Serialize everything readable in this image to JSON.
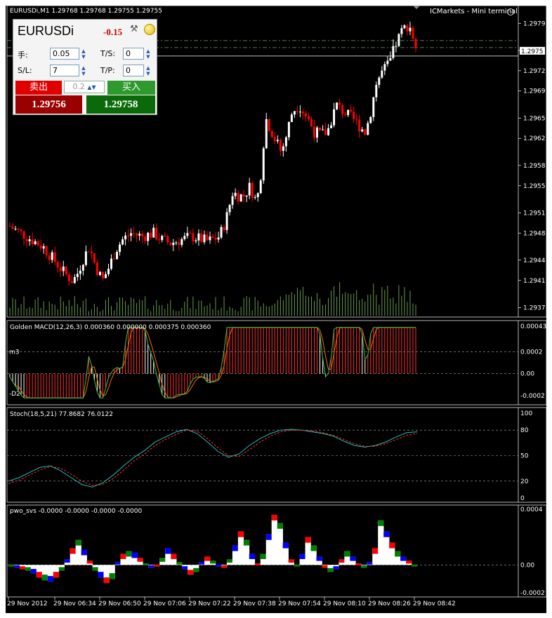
{
  "window": {
    "header_title": "EURUSDi,M1  1.29768 1.29768 1.29755 1.29755",
    "broker_label": "ICMarkets - Mini terminal"
  },
  "trade_panel": {
    "symbol": "EURUSDi",
    "change": "-0.15",
    "lots_label": "手:",
    "lots_value": "0.05",
    "ts_label": "T/S:",
    "ts_value": "0",
    "sl_label": "S/L:",
    "sl_value": "7",
    "tp_label": "T/P:",
    "tp_value": "0",
    "sell_label": "卖出",
    "sell_price": "1.29756",
    "buy_label": "买入",
    "buy_price": "1.29758",
    "spread": "0.2"
  },
  "colors": {
    "background": "#000000",
    "bull": "#ffffff",
    "bear": "#ff0000",
    "volume": "#6a9a50",
    "macd_signal": "#ff6a00",
    "stoch_main": "#20c0c0",
    "stoch_signal": "#ff3030",
    "pwo_green": "#008000",
    "pwo_blue": "#0000ff",
    "pwo_red": "#ff0000"
  },
  "chart_data": [
    {
      "type": "candlestick",
      "symbol": "EURUSDi",
      "timeframe": "M1",
      "ylim": [
        1.2936,
        1.2981
      ],
      "y_ticks": [
        "1.2979",
        "1.2975",
        "1.2972",
        "1.2969",
        "1.2965",
        "1.2962",
        "1.2958",
        "1.2955",
        "1.2951",
        "1.2948",
        "1.2944",
        "1.2941",
        "1.2937"
      ],
      "current_price": "1.2975",
      "x_ticks": [
        "29 Nov 2012",
        "29 Nov 06:34",
        "29 Nov 06:50",
        "29 Nov 07:06",
        "29 Nov 07:22",
        "29 Nov 07:38",
        "29 Nov 07:54",
        "29 Nov 08:10",
        "29 Nov 08:26",
        "29 Nov 08:42"
      ],
      "path_points": [
        [
          0,
          1.2949
        ],
        [
          10,
          1.2948
        ],
        [
          20,
          1.2947
        ],
        [
          30,
          1.2946
        ],
        [
          40,
          1.2944
        ],
        [
          50,
          1.2942
        ],
        [
          56,
          1.2941
        ],
        [
          60,
          1.29415
        ],
        [
          66,
          1.2944
        ],
        [
          72,
          1.2946
        ],
        [
          78,
          1.2943
        ],
        [
          84,
          1.2941
        ],
        [
          90,
          1.2943
        ],
        [
          96,
          1.29455
        ],
        [
          102,
          1.2947
        ],
        [
          110,
          1.2948
        ],
        [
          120,
          1.29475
        ],
        [
          130,
          1.2948
        ],
        [
          138,
          1.2947
        ],
        [
          145,
          1.29465
        ],
        [
          155,
          1.2947
        ],
        [
          165,
          1.29475
        ],
        [
          175,
          1.2947
        ],
        [
          180,
          1.29468
        ],
        [
          190,
          1.29475
        ],
        [
          196,
          1.295
        ],
        [
          202,
          1.2954
        ],
        [
          208,
          1.29535
        ],
        [
          212,
          1.29535
        ],
        [
          218,
          1.2955
        ],
        [
          222,
          1.2953
        ],
        [
          226,
          1.2954
        ],
        [
          232,
          1.2965
        ],
        [
          240,
          1.2962
        ],
        [
          246,
          1.296
        ],
        [
          250,
          1.2962
        ],
        [
          256,
          1.2966
        ],
        [
          262,
          1.2967
        ],
        [
          270,
          1.2965
        ],
        [
          276,
          1.2963
        ],
        [
          282,
          1.29625
        ],
        [
          288,
          1.2963
        ],
        [
          296,
          1.2967
        ],
        [
          302,
          1.2966
        ],
        [
          310,
          1.2965
        ],
        [
          316,
          1.2964
        ],
        [
          322,
          1.2963
        ],
        [
          326,
          1.2965
        ],
        [
          332,
          1.297
        ],
        [
          338,
          1.2972
        ],
        [
          344,
          1.2973
        ],
        [
          350,
          1.2976
        ],
        [
          356,
          1.2978
        ],
        [
          362,
          1.2979
        ],
        [
          368,
          1.29755
        ]
      ]
    },
    {
      "type": "line",
      "title": "Golden MACD(12,26,3) 0.000360 0.000000 0.000375 0.000360",
      "ylim": [
        -0.00025,
        0.00045
      ],
      "y_ticks": [
        "0.00043",
        "0.0002",
        "0.00",
        "-0.0002"
      ],
      "side_labels": [
        "m3",
        "-D2"
      ],
      "series": [
        {
          "values": [
            0,
            -6,
            -9,
            -8,
            -10,
            -12,
            -11,
            -13,
            -16,
            -18,
            -22,
            -23,
            -21,
            -16,
            -14,
            -10,
            -12,
            -14,
            -12,
            -10,
            -8,
            -4,
            -6,
            -10,
            -14,
            -16,
            -18,
            -18,
            -16,
            -14,
            -10,
            -6,
            -2,
            0,
            -2,
            -6,
            -8,
            -6,
            -4,
            0
          ]
        },
        {
          "values": [
            0,
            0,
            2,
            1,
            2,
            3,
            4,
            5,
            6,
            6,
            7,
            10,
            12,
            14,
            13,
            12,
            10,
            8,
            6,
            5,
            4,
            5,
            4,
            2,
            0,
            -2,
            -4,
            -6,
            -8,
            -10,
            -12,
            -14,
            -16,
            -18,
            -20,
            -22,
            -24,
            -26,
            -27,
            -26
          ]
        }
      ]
    },
    {
      "type": "line",
      "title": "Stoch(18,5,21) 77.8682 76.0122",
      "ylim": [
        0,
        100
      ],
      "y_ticks": [
        "100",
        "80",
        "50",
        "20",
        "0"
      ],
      "levels": [
        80,
        50,
        20
      ],
      "series": [
        {
          "name": "main",
          "values": [
            20,
            24,
            30,
            36,
            38,
            32,
            24,
            16,
            13,
            18,
            27,
            38,
            48,
            56,
            66,
            72,
            78,
            81,
            76,
            66,
            55,
            48,
            52,
            62,
            70,
            76,
            80,
            81,
            80,
            78,
            76,
            73,
            67,
            62,
            60,
            62,
            66,
            72,
            77,
            78
          ]
        },
        {
          "name": "signal",
          "values": [
            17,
            21,
            27,
            33,
            37,
            35,
            28,
            20,
            15,
            16,
            23,
            33,
            44,
            52,
            62,
            69,
            75,
            80,
            79,
            70,
            59,
            50,
            49,
            57,
            66,
            73,
            78,
            80,
            80,
            79,
            77,
            74,
            69,
            64,
            61,
            61,
            64,
            69,
            74,
            76
          ]
        }
      ]
    },
    {
      "type": "bar",
      "title": "pwo_svs -0.0000 -0.0000 -0.0000 -0.0000",
      "ylim": [
        -0.0002,
        0.0004
      ],
      "y_ticks": [
        "0.0004",
        "0.00",
        "-0.0002"
      ],
      "values": [
        -1e-05,
        -2e-05,
        -3e-05,
        -4e-05,
        -6e-05,
        -9e-05,
        -0.00011,
        -0.00012,
        -9e-05,
        -4e-05,
        4e-05,
        0.00012,
        0.00018,
        0.00011,
        3e-05,
        -4e-05,
        -9e-05,
        -0.00013,
        -0.0001,
        2e-05,
        8e-05,
        0.0001,
        9e-05,
        5e-05,
        1e-05,
        -2e-05,
        -1e-05,
        5e-05,
        0.00012,
        8e-05,
        2e-05,
        -3e-05,
        -7e-05,
        -5e-05,
        2e-05,
        6e-05,
        3e-05,
        -1e-05,
        -2e-05,
        4e-05,
        0.00014,
        0.00024,
        0.00018,
        8e-05,
        1e-05,
        8e-05,
        0.00022,
        0.00036,
        0.0003,
        0.00016,
        4e-05,
        -1e-05,
        8e-05,
        0.0002,
        0.00014,
        6e-05,
        -2e-05,
        -5e-05,
        -3e-05,
        4e-05,
        0.0001,
        6e-05,
        1e-05,
        -2e-05,
        2e-05,
        0.00012,
        0.00032,
        0.00024,
        0.00016,
        0.0001,
        6e-05,
        3e-05,
        -1e-05
      ]
    }
  ]
}
